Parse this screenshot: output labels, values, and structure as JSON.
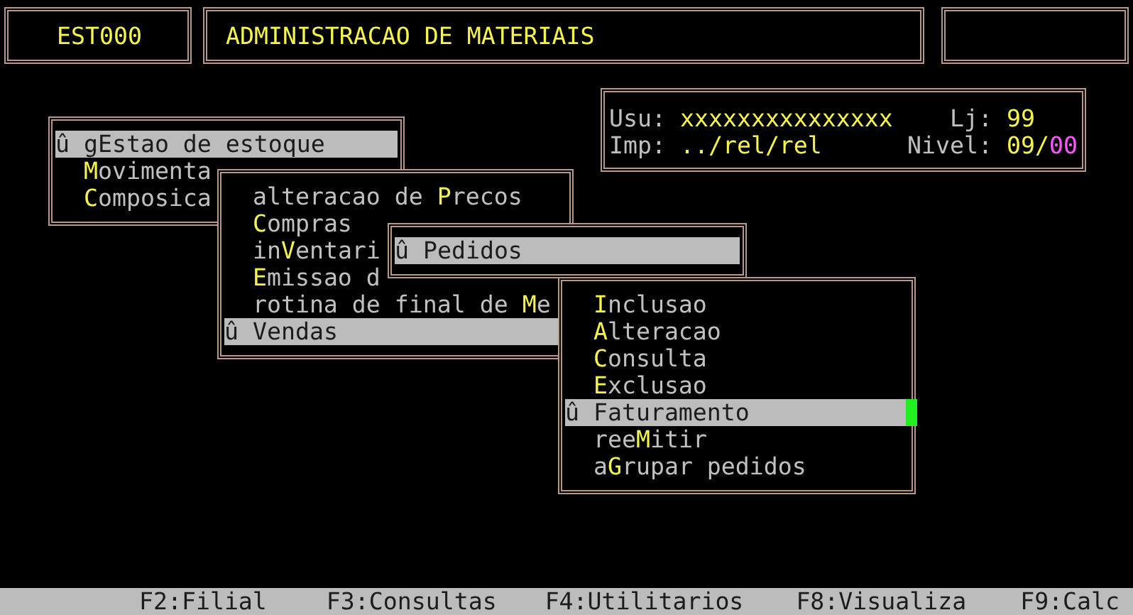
{
  "header": {
    "program_code": "EST000",
    "title": "ADMINISTRACAO DE MATERIAIS"
  },
  "info": {
    "user_label": "Usu:",
    "user": "xxxxxxxxxxxxxxx",
    "store_label": "Lj:",
    "store": "99",
    "printer_label": "Imp:",
    "printer": "../rel/rel",
    "level_label": "Nivel:",
    "level_parts": [
      {
        "text": "09/",
        "color": "#f4f44c"
      },
      {
        "text": "00",
        "color": "#ff55ff"
      }
    ]
  },
  "menus": [
    {
      "items": [
        {
          "marker": "û",
          "pre": "g",
          "hotkey": "E",
          "post": "stao de estoque",
          "selected": true
        },
        {
          "hotkey": "M",
          "post": "ovimenta",
          "selected": false
        },
        {
          "hotkey": "C",
          "post": "omposica",
          "selected": false
        }
      ]
    },
    {
      "items": [
        {
          "pre": "alteracao de ",
          "hotkey": "P",
          "post": "recos",
          "selected": false
        },
        {
          "hotkey": "C",
          "post": "ompras",
          "selected": false
        },
        {
          "pre": "in",
          "hotkey": "V",
          "post": "entari",
          "selected": false
        },
        {
          "hotkey": "E",
          "post": "missao d",
          "selected": false
        },
        {
          "pre": "rotina de final de ",
          "hotkey": "M",
          "post": "e",
          "selected": false
        },
        {
          "marker": "û",
          "hotkey": "V",
          "post": "endas",
          "selected": true
        }
      ]
    },
    {
      "items": [
        {
          "marker": "û",
          "hotkey": "P",
          "post": "edidos",
          "selected": true
        }
      ]
    },
    {
      "items": [
        {
          "hotkey": "I",
          "post": "nclusao",
          "selected": false
        },
        {
          "hotkey": "A",
          "post": "lteracao",
          "selected": false
        },
        {
          "hotkey": "C",
          "post": "onsulta",
          "selected": false
        },
        {
          "hotkey": "E",
          "post": "xclusao",
          "selected": false
        },
        {
          "marker": "û",
          "hotkey": "F",
          "post": "aturamento",
          "selected": true
        },
        {
          "pre": "ree",
          "hotkey": "M",
          "post": "itir",
          "selected": false
        },
        {
          "pre": "a",
          "hotkey": "G",
          "post": "rupar pedidos",
          "selected": false
        }
      ]
    }
  ],
  "status_bar": [
    "F2:Filial",
    "F3:Consultas",
    "F4:Utilitarios",
    "F8:Visualiza",
    "F9:Calc"
  ]
}
